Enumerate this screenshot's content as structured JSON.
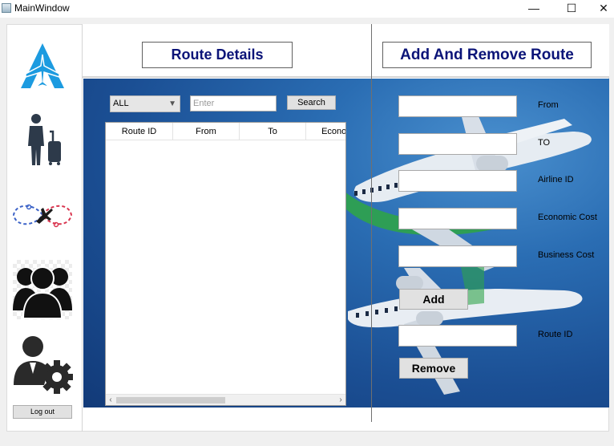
{
  "window": {
    "title": "MainWindow",
    "minimize_glyph": "—",
    "maximize_glyph": "☐",
    "close_glyph": "✕"
  },
  "sidebar": {
    "items": [
      {
        "icon": "airline-logo-icon"
      },
      {
        "icon": "traveler-luggage-icon"
      },
      {
        "icon": "flight-route-icon"
      },
      {
        "icon": "users-group-icon"
      },
      {
        "icon": "admin-settings-icon"
      }
    ],
    "logout_label": "Log out"
  },
  "route_details": {
    "title": "Route Details",
    "filter": {
      "selected": "ALL"
    },
    "search": {
      "placeholder": "Enter",
      "button_label": "Search"
    },
    "table": {
      "columns": [
        "Route ID",
        "From",
        "To",
        "Economy"
      ],
      "rows": []
    }
  },
  "add_remove": {
    "title": "Add And Remove Route",
    "fields": [
      {
        "label": "From",
        "value": ""
      },
      {
        "label": "TO",
        "value": ""
      },
      {
        "label": "Airline ID",
        "value": ""
      },
      {
        "label": "Economic Cost",
        "value": ""
      },
      {
        "label": "Business Cost",
        "value": ""
      }
    ],
    "add_label": "Add",
    "route_id": {
      "label": "Route ID",
      "value": ""
    },
    "remove_label": "Remove"
  },
  "colors": {
    "title_text": "#0b1478",
    "sky": "#1b4f94",
    "accent_blue": "#1c9be0"
  }
}
